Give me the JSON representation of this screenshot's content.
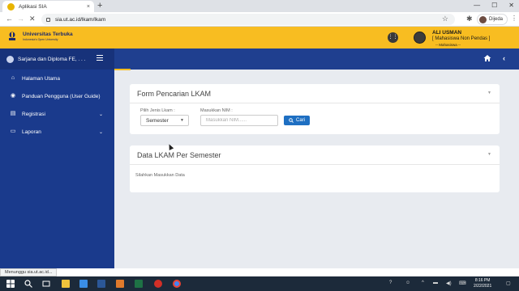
{
  "browser": {
    "tab_title": "Aplikasi SIA",
    "tab_close": "×",
    "new_tab": "+",
    "url": "sia.ut.ac.id/lkam/lkam",
    "profile_name": "Dijeda",
    "window_controls": [
      "—",
      "☐",
      "✕"
    ]
  },
  "header": {
    "logo_name": "Universitas Terbuka",
    "logo_tagline": "Indonesia's Open University",
    "user_name": "ALI USMAN",
    "user_role": "[ Mahasiswa Non Pendas ]",
    "user_sub": "-- Mahasiswa --",
    "apps_icon": "grid-icon"
  },
  "sidebar": {
    "top_label": "Sarjana dan Diploma FE, . . .",
    "items": [
      {
        "label": "Halaman Utama",
        "icon": "home-icon",
        "chevron": false
      },
      {
        "label": "Panduan Pengguna (User Guide)",
        "icon": "guide-icon",
        "chevron": false
      },
      {
        "label": "Registrasi",
        "icon": "registration-icon",
        "chevron": true
      },
      {
        "label": "Laporan",
        "icon": "print-icon",
        "chevron": true
      }
    ]
  },
  "search_card": {
    "title": "Form Pencarian LKAM",
    "jenis_label": "Pilih Jenis Lkam :",
    "jenis_value": "Semester",
    "nim_label": "Masukkan NIM :",
    "nim_placeholder": "Masukkan NIM......",
    "search_button": "Cari"
  },
  "data_card": {
    "title": "Data LKAM Per Semester",
    "message": "Silahkan Masukkan Data"
  },
  "status_bar": {
    "text": "Menunggu sia.ut.ac.id..."
  },
  "taskbar": {
    "time": "8:16 PM",
    "date": "2/22/2021",
    "icons": [
      "windows-icon",
      "search-icon",
      "taskview-icon",
      "explorer-icon",
      "word-icon",
      "paint-icon",
      "excel-icon",
      "record-icon",
      "chrome-icon"
    ],
    "colors": [
      "#ffffff",
      "#ffffff",
      "#ffffff",
      "#f0c33c",
      "#2b5797",
      "#e07a2c",
      "#1e7145",
      "#d22f27",
      "#4285f4"
    ]
  }
}
